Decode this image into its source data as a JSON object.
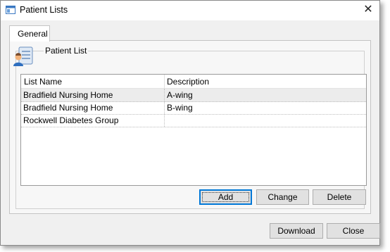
{
  "window": {
    "title": "Patient Lists",
    "icon": "window-app-icon",
    "close_glyph": "✕"
  },
  "tabs": [
    {
      "label": "General",
      "active": true
    }
  ],
  "group": {
    "label": "Patient List",
    "icon": "patient-list-icon"
  },
  "list": {
    "columns": [
      "List Name",
      "Description"
    ],
    "rows": [
      {
        "name": "Bradfield Nursing Home",
        "description": "A-wing",
        "selected": true
      },
      {
        "name": "Bradfield Nursing Home",
        "description": "B-wing",
        "selected": false
      },
      {
        "name": "Rockwell Diabetes Group",
        "description": "",
        "selected": false
      }
    ]
  },
  "buttons": {
    "add": "Add",
    "change": "Change",
    "delete": "Delete",
    "download": "Download",
    "close": "Close"
  },
  "colors": {
    "accent": "#0078d7",
    "button_face": "#e1e1e1",
    "window_bg": "#f0f0f0"
  }
}
